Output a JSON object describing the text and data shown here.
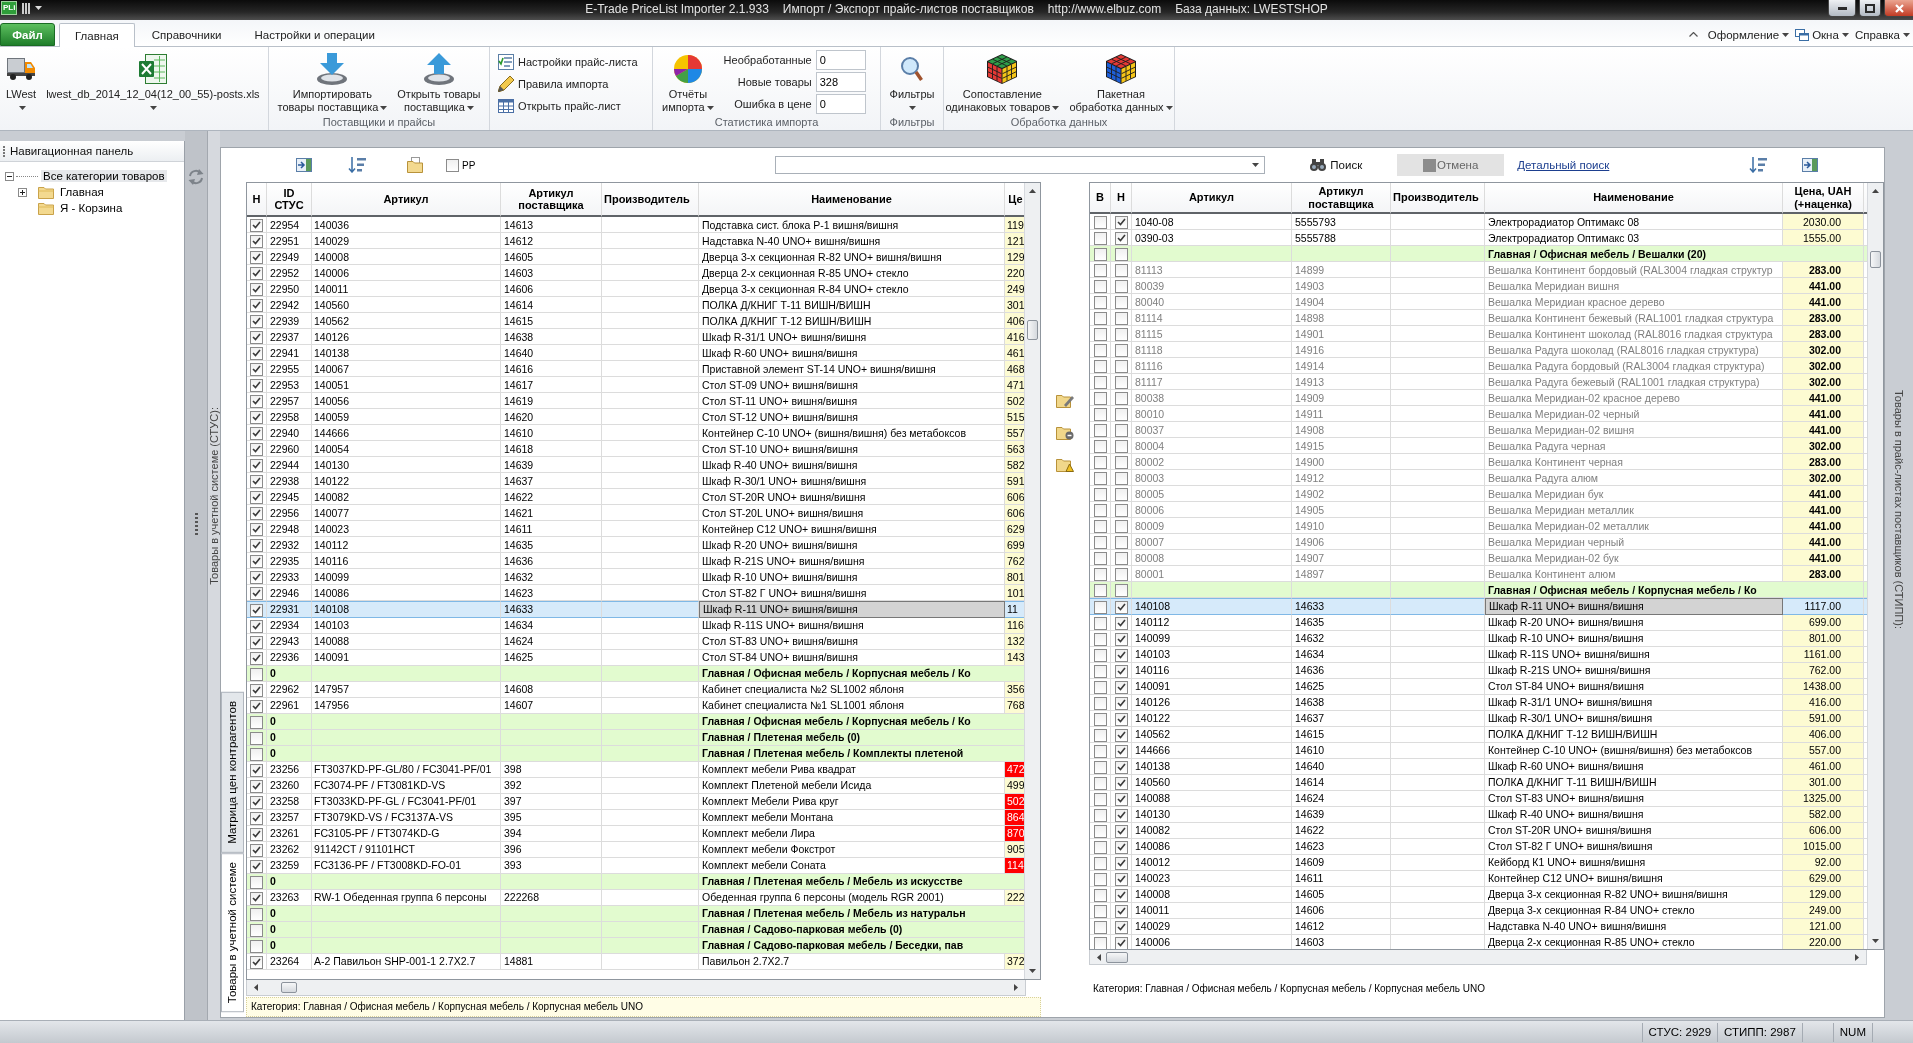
{
  "title_bar": {
    "app_logo": "PLi",
    "title_parts": [
      "E-Trade PriceList Importer 2.1.933",
      "Импорт / Экспорт прайс-листов поставщиков",
      "http://www.elbuz.com",
      "База данных: LWESTSHOP"
    ]
  },
  "file_button": "Файл",
  "ribbon_tabs": [
    {
      "label": "Главная",
      "selected": true
    },
    {
      "label": "Справочники",
      "selected": false
    },
    {
      "label": "Настройки и операции",
      "selected": false
    }
  ],
  "ribbon_menus": [
    {
      "label": "Оформление",
      "kind": "menu"
    },
    {
      "label": "Окна",
      "kind": "icon-menu"
    },
    {
      "label": "Справка",
      "kind": "menu"
    }
  ],
  "ribbon_groups": [
    {
      "items": [
        {
          "kind": "large",
          "label_lines": [
            "LWest"
          ],
          "dropdown": true
        },
        {
          "kind": "large",
          "label_lines": [
            "lwest_db_2014_12_04(12_00_55)-posts.xls"
          ],
          "dropdown": true
        }
      ]
    },
    {
      "label": "Поставщики и прайсы",
      "items": [
        {
          "kind": "large",
          "label_lines": [
            "Импортировать",
            "товары поставщика"
          ],
          "dropdown": true
        },
        {
          "kind": "large",
          "label_lines": [
            "Открыть товары",
            "поставщика"
          ],
          "dropdown": true
        }
      ]
    },
    {
      "items": [
        {
          "kind": "small",
          "label_lines": [
            "Настройки прайс-листа"
          ]
        },
        {
          "kind": "small",
          "label_lines": [
            "Правила импорта"
          ]
        },
        {
          "kind": "small",
          "label_lines": [
            "Открыть прайс-лист"
          ]
        }
      ]
    },
    {
      "label": "Статистика импорта",
      "items": [
        {
          "kind": "large",
          "label_lines": [
            "Отчёты",
            "импорта"
          ],
          "dropdown": true
        },
        {
          "kind": "stats",
          "rows": [
            {
              "label": "Необработанные",
              "value": "0"
            },
            {
              "label": "Новые товары",
              "value": "328"
            },
            {
              "label": "Ошибка в цене",
              "value": "0"
            }
          ]
        }
      ]
    },
    {
      "label": "Фильтры",
      "items": [
        {
          "kind": "large",
          "label_lines": [
            "Фильтры"
          ],
          "dropdown": true
        }
      ]
    },
    {
      "label": "Обработка данных",
      "items": [
        {
          "kind": "large",
          "label_lines": [
            "Сопоставление",
            "одинаковых товаров"
          ],
          "dropdown": true
        },
        {
          "kind": "large",
          "label_lines": [
            "Пакетная",
            "обработка данных"
          ],
          "dropdown": true
        }
      ]
    }
  ],
  "navigation_panel": {
    "title": "Навигационная панель",
    "tree": [
      {
        "label": "Все категории товаров",
        "expanded": true,
        "selected": true,
        "children": [
          {
            "label": "Главная",
            "expanded": false,
            "selected": false
          },
          {
            "label": "Я - Корзина",
            "selected": false
          }
        ]
      }
    ]
  },
  "stus_caption": "Товары в учетной системе (СТУС):",
  "stipp_caption": "Товары в прайс-листах поставщиков (СТИПП):",
  "toolbar": {
    "pp_checkbox": {
      "label": "PP",
      "checked": false
    },
    "search_button": {
      "label": "Поиск",
      "disabled": false
    },
    "cancel_button": {
      "label": "Отмена",
      "disabled": true
    },
    "advanced_search_link": "Детальный поиск"
  },
  "view_tabs": [
    {
      "label": "Матрица цен контрагентов",
      "selected": false
    },
    {
      "label": "Товары в учетной системе",
      "selected": true
    }
  ],
  "stus_table": {
    "columns": [
      "Н",
      "ID\nСТУС",
      "Артикул",
      "Артикул\nпоставщика",
      "Производитель",
      "Наименование",
      "Це"
    ],
    "rows": [
      {
        "kind": "item",
        "checked": true,
        "selected": false,
        "id": "22954",
        "article": "140036",
        "supplier_article": "14613",
        "name": "Подставка сист. блока Р-1 вишня/вишня",
        "price": "119",
        "price_error": false
      },
      {
        "kind": "item",
        "checked": true,
        "selected": false,
        "id": "22951",
        "article": "140029",
        "supplier_article": "14612",
        "name": "Надставка N-40 UNO+ вишня/вишня",
        "price": "121",
        "price_error": false
      },
      {
        "kind": "item",
        "checked": true,
        "selected": false,
        "id": "22949",
        "article": "140008",
        "supplier_article": "14605",
        "name": "Дверца 3-х секционная R-82 UNO+ вишня/вишня",
        "price": "129",
        "price_error": false
      },
      {
        "kind": "item",
        "checked": true,
        "selected": false,
        "id": "22952",
        "article": "140006",
        "supplier_article": "14603",
        "name": "Дверца 2-х секционная R-85 UNO+ стекло",
        "price": "220",
        "price_error": false
      },
      {
        "kind": "item",
        "checked": true,
        "selected": false,
        "id": "22950",
        "article": "140011",
        "supplier_article": "14606",
        "name": "Дверца 3-х секционная R-84 UNO+ стекло",
        "price": "249",
        "price_error": false
      },
      {
        "kind": "item",
        "checked": true,
        "selected": false,
        "id": "22942",
        "article": "140560",
        "supplier_article": "14614",
        "name": "ПОЛКА Д/КНИГ Т-11 ВИШН/ВИШН",
        "price": "301",
        "price_error": false
      },
      {
        "kind": "item",
        "checked": true,
        "selected": false,
        "id": "22939",
        "article": "140562",
        "supplier_article": "14615",
        "name": "ПОЛКА Д/КНИГ Т-12 ВИШН/ВИШН",
        "price": "406",
        "price_error": false
      },
      {
        "kind": "item",
        "checked": true,
        "selected": false,
        "id": "22937",
        "article": "140126",
        "supplier_article": "14638",
        "name": "Шкаф R-31/1 UNO+ вишня/вишня",
        "price": "416",
        "price_error": false
      },
      {
        "kind": "item",
        "checked": true,
        "selected": false,
        "id": "22941",
        "article": "140138",
        "supplier_article": "14640",
        "name": "Шкаф R-60 UNO+ вишня/вишня",
        "price": "461",
        "price_error": false
      },
      {
        "kind": "item",
        "checked": true,
        "selected": false,
        "id": "22955",
        "article": "140067",
        "supplier_article": "14616",
        "name": "Приставной элемент ST-14 UNO+ вишня/вишня",
        "price": "468",
        "price_error": false
      },
      {
        "kind": "item",
        "checked": true,
        "selected": false,
        "id": "22953",
        "article": "140051",
        "supplier_article": "14617",
        "name": "Стол ST-09 UNO+ вишня/вишня",
        "price": "471",
        "price_error": false
      },
      {
        "kind": "item",
        "checked": true,
        "selected": false,
        "id": "22957",
        "article": "140056",
        "supplier_article": "14619",
        "name": "Стол ST-11 UNO+ вишня/вишня",
        "price": "502",
        "price_error": false
      },
      {
        "kind": "item",
        "checked": true,
        "selected": false,
        "id": "22958",
        "article": "140059",
        "supplier_article": "14620",
        "name": "Стол ST-12 UNO+ вишня/вишня",
        "price": "515",
        "price_error": false
      },
      {
        "kind": "item",
        "checked": true,
        "selected": false,
        "id": "22940",
        "article": "144666",
        "supplier_article": "14610",
        "name": "Контейнер С-10 UNO+ (вишня/вишня) без метабоксов",
        "price": "557",
        "price_error": false
      },
      {
        "kind": "item",
        "checked": true,
        "selected": false,
        "id": "22960",
        "article": "140054",
        "supplier_article": "14618",
        "name": "Стол ST-10 UNO+ вишня/вишня",
        "price": "563",
        "price_error": false
      },
      {
        "kind": "item",
        "checked": true,
        "selected": false,
        "id": "22944",
        "article": "140130",
        "supplier_article": "14639",
        "name": "Шкаф R-40 UNO+ вишня/вишня",
        "price": "582",
        "price_error": false
      },
      {
        "kind": "item",
        "checked": true,
        "selected": false,
        "id": "22938",
        "article": "140122",
        "supplier_article": "14637",
        "name": "Шкаф R-30/1 UNO+ вишня/вишня",
        "price": "591",
        "price_error": false
      },
      {
        "kind": "item",
        "checked": true,
        "selected": false,
        "id": "22945",
        "article": "140082",
        "supplier_article": "14622",
        "name": "Стол ST-20R UNO+ вишня/вишня",
        "price": "606",
        "price_error": false
      },
      {
        "kind": "item",
        "checked": true,
        "selected": false,
        "id": "22956",
        "article": "140077",
        "supplier_article": "14621",
        "name": "Стол ST-20L UNO+ вишня/вишня",
        "price": "606",
        "price_error": false
      },
      {
        "kind": "item",
        "checked": true,
        "selected": false,
        "id": "22948",
        "article": "140023",
        "supplier_article": "14611",
        "name": "Контейнер С12 UNO+ вишня/вишня",
        "price": "629",
        "price_error": false
      },
      {
        "kind": "item",
        "checked": true,
        "selected": false,
        "id": "22932",
        "article": "140112",
        "supplier_article": "14635",
        "name": "Шкаф R-20 UNO+ вишня/вишня",
        "price": "699",
        "price_error": false
      },
      {
        "kind": "item",
        "checked": true,
        "selected": false,
        "id": "22935",
        "article": "140116",
        "supplier_article": "14636",
        "name": "Шкаф R-21S UNO+ вишня/вишня",
        "price": "762",
        "price_error": false
      },
      {
        "kind": "item",
        "checked": true,
        "selected": false,
        "id": "22933",
        "article": "140099",
        "supplier_article": "14632",
        "name": "Шкаф R-10 UNO+ вишня/вишня",
        "price": "801",
        "price_error": false
      },
      {
        "kind": "item",
        "checked": true,
        "selected": false,
        "id": "22946",
        "article": "140086",
        "supplier_article": "14623",
        "name": "Стол ST-82 Г UNO+ вишня/вишня",
        "price": "101",
        "price_error": false
      },
      {
        "kind": "item",
        "checked": true,
        "selected": true,
        "id": "22931",
        "article": "140108",
        "supplier_article": "14633",
        "name": "Шкаф R-11 UNO+ вишня/вишня",
        "price": "11",
        "price_error": false
      },
      {
        "kind": "item",
        "checked": true,
        "selected": false,
        "id": "22934",
        "article": "140103",
        "supplier_article": "14634",
        "name": "Шкаф R-11S UNO+ вишня/вишня",
        "price": "116",
        "price_error": false
      },
      {
        "kind": "item",
        "checked": true,
        "selected": false,
        "id": "22943",
        "article": "140088",
        "supplier_article": "14624",
        "name": "Стол ST-83 UNO+ вишня/вишня",
        "price": "132",
        "price_error": false
      },
      {
        "kind": "item",
        "checked": true,
        "selected": false,
        "id": "22936",
        "article": "140091",
        "supplier_article": "14625",
        "name": "Стол ST-84 UNO+ вишня/вишня",
        "price": "143",
        "price_error": false
      },
      {
        "kind": "group",
        "checked": false,
        "selected": false,
        "id": "0",
        "name": "Главная / Офисная мебель / Корпусная мебель / Ко"
      },
      {
        "kind": "item",
        "checked": true,
        "selected": false,
        "id": "22962",
        "article": "147957",
        "supplier_article": "14608",
        "name": "Кабинет специалиста №2 SL1002 яблоня",
        "price": "356",
        "price_error": false
      },
      {
        "kind": "item",
        "checked": true,
        "selected": false,
        "id": "22961",
        "article": "147956",
        "supplier_article": "14607",
        "name": "Кабинет специалиста №1 SL1001 яблоня",
        "price": "768",
        "price_error": false
      },
      {
        "kind": "group",
        "checked": false,
        "selected": false,
        "id": "0",
        "name": "Главная / Офисная мебель / Корпусная мебель / Ко"
      },
      {
        "kind": "group",
        "checked": false,
        "selected": false,
        "id": "0",
        "name": "Главная / Плетеная мебель (0)"
      },
      {
        "kind": "group",
        "checked": false,
        "selected": false,
        "id": "0",
        "name": "Главная / Плетеная мебель / Комплекты плетеной"
      },
      {
        "kind": "item",
        "checked": true,
        "selected": false,
        "id": "23256",
        "article": "FT3037KD-PF-GL/80 / FC3041-PF/01",
        "supplier_article": "398",
        "name": "Комплект мебели Рива квадрат",
        "price": "472",
        "price_error": true
      },
      {
        "kind": "item",
        "checked": true,
        "selected": false,
        "id": "23260",
        "article": "FC3074-PF / FT3081KD-VS",
        "supplier_article": "392",
        "name": "Комплект Плетеной мебели Исида",
        "price": "499",
        "price_error": false
      },
      {
        "kind": "item",
        "checked": true,
        "selected": false,
        "id": "23258",
        "article": "FT3033KD-PF-GL / FC3041-PF/01",
        "supplier_article": "397",
        "name": "Комплект Мебели Рива круг",
        "price": "502",
        "price_error": true
      },
      {
        "kind": "item",
        "checked": true,
        "selected": false,
        "id": "23257",
        "article": "FT3079KD-VS / FC3137A-VS",
        "supplier_article": "395",
        "name": "Комплект мебели Монтана",
        "price": "864",
        "price_error": true
      },
      {
        "kind": "item",
        "checked": true,
        "selected": false,
        "id": "23261",
        "article": "FC3105-PF / FT3074KD-G",
        "supplier_article": "394",
        "name": "Комплект мебели Лира",
        "price": "870",
        "price_error": true
      },
      {
        "kind": "item",
        "checked": true,
        "selected": false,
        "id": "23262",
        "article": "91142CT / 91101HCT",
        "supplier_article": "396",
        "name": "Комплект мебели Фокстрот",
        "price": "905",
        "price_error": false
      },
      {
        "kind": "item",
        "checked": true,
        "selected": false,
        "id": "23259",
        "article": "FC3136-PF / FT3008KD-FO-01",
        "supplier_article": "393",
        "name": "Комплект мебели Соната",
        "price": "114",
        "price_error": true
      },
      {
        "kind": "group",
        "checked": false,
        "selected": false,
        "id": "0",
        "name": "Главная / Плетеная мебель / Мебель из искусстве"
      },
      {
        "kind": "item",
        "checked": true,
        "selected": false,
        "id": "23263",
        "article": "RW-1 Обеденная группа 6 персоны",
        "supplier_article": "222268",
        "name": "Обеденная группа 6 персоны (модель RGR 2001)",
        "price": "222",
        "price_error": false
      },
      {
        "kind": "group",
        "checked": false,
        "selected": false,
        "id": "0",
        "name": "Главная / Плетеная мебель / Мебель из натуральн"
      },
      {
        "kind": "group",
        "checked": false,
        "selected": false,
        "id": "0",
        "name": "Главная / Садово-парковая мебель (0)"
      },
      {
        "kind": "group",
        "checked": false,
        "selected": false,
        "id": "0",
        "name": "Главная / Садово-парковая мебель / Беседки, пав"
      },
      {
        "kind": "item",
        "checked": true,
        "selected": false,
        "id": "23264",
        "article": "A-2 Павильон SHP-001-1 2.7X2.7",
        "supplier_article": "14881",
        "name": "Павильон 2.7X2.7",
        "price": "372",
        "price_error": false
      }
    ],
    "category": "Категория: Главная / Офисная мебель / Корпусная мебель / Корпусная мебель UNO"
  },
  "pricelist_table": {
    "columns": [
      "В",
      "Н",
      "Артикул",
      "Артикул\nпоставщика",
      "Производитель",
      "Наименование",
      "Цена, UAH\n(+наценка)"
    ],
    "rows": [
      {
        "kind": "item",
        "v_checked": false,
        "n_checked": true,
        "selected": false,
        "inactive": false,
        "article": "1040-08",
        "supplier_article": "5555793",
        "name": "Электрорадиатор Оптимакс 08",
        "price": "2030.00"
      },
      {
        "kind": "item",
        "v_checked": false,
        "n_checked": true,
        "selected": false,
        "inactive": false,
        "article": "0390-03",
        "supplier_article": "5555788",
        "name": "Электрорадиатор Оптимакс 03",
        "price": "1555.00"
      },
      {
        "kind": "group",
        "v_checked": false,
        "n_checked": false,
        "selected": false,
        "name": "Главная / Офисная мебель / Вешалки (20)"
      },
      {
        "kind": "item",
        "v_checked": false,
        "n_checked": false,
        "selected": false,
        "inactive": true,
        "article": "81113",
        "supplier_article": "14899",
        "name": "Вешалка Континент бордовый (RAL3004 гладкая структур",
        "price": "283.00"
      },
      {
        "kind": "item",
        "v_checked": false,
        "n_checked": false,
        "selected": false,
        "inactive": true,
        "article": "80039",
        "supplier_article": "14903",
        "name": "Вешалка Меридиан вишня",
        "price": "441.00"
      },
      {
        "kind": "item",
        "v_checked": false,
        "n_checked": false,
        "selected": false,
        "inactive": true,
        "article": "80040",
        "supplier_article": "14904",
        "name": "Вешалка Меридиан красное дерево",
        "price": "441.00"
      },
      {
        "kind": "item",
        "v_checked": false,
        "n_checked": false,
        "selected": false,
        "inactive": true,
        "article": "81114",
        "supplier_article": "14898",
        "name": "Вешалка Континент бежевый (RAL1001 гладкая структура",
        "price": "283.00"
      },
      {
        "kind": "item",
        "v_checked": false,
        "n_checked": false,
        "selected": false,
        "inactive": true,
        "article": "81115",
        "supplier_article": "14901",
        "name": "Вешалка Континент шоколад (RAL8016 гладкая структура",
        "price": "283.00"
      },
      {
        "kind": "item",
        "v_checked": false,
        "n_checked": false,
        "selected": false,
        "inactive": true,
        "article": "81118",
        "supplier_article": "14916",
        "name": "Вешалка Радуга шоколад (RAL8016 гладкая структура)",
        "price": "302.00"
      },
      {
        "kind": "item",
        "v_checked": false,
        "n_checked": false,
        "selected": false,
        "inactive": true,
        "article": "81116",
        "supplier_article": "14914",
        "name": "Вешалка Радуга бордовый (RAL3004 гладкая структура)",
        "price": "302.00"
      },
      {
        "kind": "item",
        "v_checked": false,
        "n_checked": false,
        "selected": false,
        "inactive": true,
        "article": "81117",
        "supplier_article": "14913",
        "name": "Вешалка Радуга бежевый (RAL1001 гладкая структура)",
        "price": "302.00"
      },
      {
        "kind": "item",
        "v_checked": false,
        "n_checked": false,
        "selected": false,
        "inactive": true,
        "article": "80038",
        "supplier_article": "14909",
        "name": "Вешалка Меридиан-02 красное дерево",
        "price": "441.00"
      },
      {
        "kind": "item",
        "v_checked": false,
        "n_checked": false,
        "selected": false,
        "inactive": true,
        "article": "80010",
        "supplier_article": "14911",
        "name": "Вешалка Меридиан-02 черный",
        "price": "441.00"
      },
      {
        "kind": "item",
        "v_checked": false,
        "n_checked": false,
        "selected": false,
        "inactive": true,
        "article": "80037",
        "supplier_article": "14908",
        "name": "Вешалка Меридиан-02 вишня",
        "price": "441.00"
      },
      {
        "kind": "item",
        "v_checked": false,
        "n_checked": false,
        "selected": false,
        "inactive": true,
        "article": "80004",
        "supplier_article": "14915",
        "name": "Вешалка Радуга черная",
        "price": "302.00"
      },
      {
        "kind": "item",
        "v_checked": false,
        "n_checked": false,
        "selected": false,
        "inactive": true,
        "article": "80002",
        "supplier_article": "14900",
        "name": "Вешалка Континент черная",
        "price": "283.00"
      },
      {
        "kind": "item",
        "v_checked": false,
        "n_checked": false,
        "selected": false,
        "inactive": true,
        "article": "80003",
        "supplier_article": "14912",
        "name": "Вешалка Радуга алюм",
        "price": "302.00"
      },
      {
        "kind": "item",
        "v_checked": false,
        "n_checked": false,
        "selected": false,
        "inactive": true,
        "article": "80005",
        "supplier_article": "14902",
        "name": "Вешалка Меридиан бук",
        "price": "441.00"
      },
      {
        "kind": "item",
        "v_checked": false,
        "n_checked": false,
        "selected": false,
        "inactive": true,
        "article": "80006",
        "supplier_article": "14905",
        "name": "Вешалка Меридиан металлик",
        "price": "441.00"
      },
      {
        "kind": "item",
        "v_checked": false,
        "n_checked": false,
        "selected": false,
        "inactive": true,
        "article": "80009",
        "supplier_article": "14910",
        "name": "Вешалка Меридиан-02 металлик",
        "price": "441.00"
      },
      {
        "kind": "item",
        "v_checked": false,
        "n_checked": false,
        "selected": false,
        "inactive": true,
        "article": "80007",
        "supplier_article": "14906",
        "name": "Вешалка Меридиан черный",
        "price": "441.00"
      },
      {
        "kind": "item",
        "v_checked": false,
        "n_checked": false,
        "selected": false,
        "inactive": true,
        "article": "80008",
        "supplier_article": "14907",
        "name": "Вешалка Меридиан-02 бук",
        "price": "441.00"
      },
      {
        "kind": "item",
        "v_checked": false,
        "n_checked": false,
        "selected": false,
        "inactive": true,
        "article": "80001",
        "supplier_article": "14897",
        "name": "Вешалка Континент алюм",
        "price": "283.00"
      },
      {
        "kind": "group",
        "v_checked": false,
        "n_checked": false,
        "selected": false,
        "name": "Главная / Офисная мебель / Корпусная мебель / Ко"
      },
      {
        "kind": "item",
        "v_checked": false,
        "n_checked": true,
        "selected": true,
        "inactive": false,
        "article": "140108",
        "supplier_article": "14633",
        "name": "Шкаф R-11 UNO+ вишня/вишня",
        "price": "1117.00"
      },
      {
        "kind": "item",
        "v_checked": false,
        "n_checked": true,
        "selected": false,
        "inactive": false,
        "article": "140112",
        "supplier_article": "14635",
        "name": "Шкаф R-20 UNO+ вишня/вишня",
        "price": "699.00"
      },
      {
        "kind": "item",
        "v_checked": false,
        "n_checked": true,
        "selected": false,
        "inactive": false,
        "article": "140099",
        "supplier_article": "14632",
        "name": "Шкаф R-10 UNO+ вишня/вишня",
        "price": "801.00"
      },
      {
        "kind": "item",
        "v_checked": false,
        "n_checked": true,
        "selected": false,
        "inactive": false,
        "article": "140103",
        "supplier_article": "14634",
        "name": "Шкаф R-11S UNO+ вишня/вишня",
        "price": "1161.00"
      },
      {
        "kind": "item",
        "v_checked": false,
        "n_checked": true,
        "selected": false,
        "inactive": false,
        "article": "140116",
        "supplier_article": "14636",
        "name": "Шкаф R-21S UNO+ вишня/вишня",
        "price": "762.00"
      },
      {
        "kind": "item",
        "v_checked": false,
        "n_checked": true,
        "selected": false,
        "inactive": false,
        "article": "140091",
        "supplier_article": "14625",
        "name": "Стол ST-84 UNO+ вишня/вишня",
        "price": "1438.00"
      },
      {
        "kind": "item",
        "v_checked": false,
        "n_checked": true,
        "selected": false,
        "inactive": false,
        "article": "140126",
        "supplier_article": "14638",
        "name": "Шкаф R-31/1 UNO+ вишня/вишня",
        "price": "416.00"
      },
      {
        "kind": "item",
        "v_checked": false,
        "n_checked": true,
        "selected": false,
        "inactive": false,
        "article": "140122",
        "supplier_article": "14637",
        "name": "Шкаф R-30/1 UNO+ вишня/вишня",
        "price": "591.00"
      },
      {
        "kind": "item",
        "v_checked": false,
        "n_checked": true,
        "selected": false,
        "inactive": false,
        "article": "140562",
        "supplier_article": "14615",
        "name": "ПОЛКА Д/КНИГ Т-12 ВИШН/ВИШН",
        "price": "406.00"
      },
      {
        "kind": "item",
        "v_checked": false,
        "n_checked": true,
        "selected": false,
        "inactive": false,
        "article": "144666",
        "supplier_article": "14610",
        "name": "Контейнер С-10 UNO+ (вишня/вишня) без метабоксов",
        "price": "557.00"
      },
      {
        "kind": "item",
        "v_checked": false,
        "n_checked": true,
        "selected": false,
        "inactive": false,
        "article": "140138",
        "supplier_article": "14640",
        "name": "Шкаф R-60 UNO+ вишня/вишня",
        "price": "461.00"
      },
      {
        "kind": "item",
        "v_checked": false,
        "n_checked": true,
        "selected": false,
        "inactive": false,
        "article": "140560",
        "supplier_article": "14614",
        "name": "ПОЛКА Д/КНИГ Т-11 ВИШН/ВИШН",
        "price": "301.00"
      },
      {
        "kind": "item",
        "v_checked": false,
        "n_checked": true,
        "selected": false,
        "inactive": false,
        "article": "140088",
        "supplier_article": "14624",
        "name": "Стол ST-83 UNO+ вишня/вишня",
        "price": "1325.00"
      },
      {
        "kind": "item",
        "v_checked": false,
        "n_checked": true,
        "selected": false,
        "inactive": false,
        "article": "140130",
        "supplier_article": "14639",
        "name": "Шкаф R-40 UNO+ вишня/вишня",
        "price": "582.00"
      },
      {
        "kind": "item",
        "v_checked": false,
        "n_checked": true,
        "selected": false,
        "inactive": false,
        "article": "140082",
        "supplier_article": "14622",
        "name": "Стол ST-20R UNO+ вишня/вишня",
        "price": "606.00"
      },
      {
        "kind": "item",
        "v_checked": false,
        "n_checked": true,
        "selected": false,
        "inactive": false,
        "article": "140086",
        "supplier_article": "14623",
        "name": "Стол ST-82 Г UNO+ вишня/вишня",
        "price": "1015.00"
      },
      {
        "kind": "item",
        "v_checked": false,
        "n_checked": true,
        "selected": false,
        "inactive": false,
        "article": "140012",
        "supplier_article": "14609",
        "name": "Кейборд К1 UNO+ вишня/вишня",
        "price": "92.00"
      },
      {
        "kind": "item",
        "v_checked": false,
        "n_checked": true,
        "selected": false,
        "inactive": false,
        "article": "140023",
        "supplier_article": "14611",
        "name": "Контейнер С12 UNO+ вишня/вишня",
        "price": "629.00"
      },
      {
        "kind": "item",
        "v_checked": false,
        "n_checked": true,
        "selected": false,
        "inactive": false,
        "article": "140008",
        "supplier_article": "14605",
        "name": "Дверца 3-х секционная R-82 UNO+ вишня/вишня",
        "price": "129.00"
      },
      {
        "kind": "item",
        "v_checked": false,
        "n_checked": true,
        "selected": false,
        "inactive": false,
        "article": "140011",
        "supplier_article": "14606",
        "name": "Дверца 3-х секционная R-84 UNO+ стекло",
        "price": "249.00"
      },
      {
        "kind": "item",
        "v_checked": false,
        "n_checked": true,
        "selected": false,
        "inactive": false,
        "article": "140029",
        "supplier_article": "14612",
        "name": "Надставка N-40 UNO+ вишня/вишня",
        "price": "121.00"
      },
      {
        "kind": "item",
        "v_checked": false,
        "n_checked": true,
        "selected": false,
        "inactive": false,
        "article": "140006",
        "supplier_article": "14603",
        "name": "Дверца 2-х секционная R-85 UNO+ стекло",
        "price": "220.00"
      }
    ],
    "category": "Категория: Главная / Офисная мебель / Корпусная мебель / Корпусная мебель UNO"
  },
  "status_bar": {
    "panels": [
      "СТУС: 2929",
      "СТИПП: 2987",
      "NUM"
    ]
  }
}
